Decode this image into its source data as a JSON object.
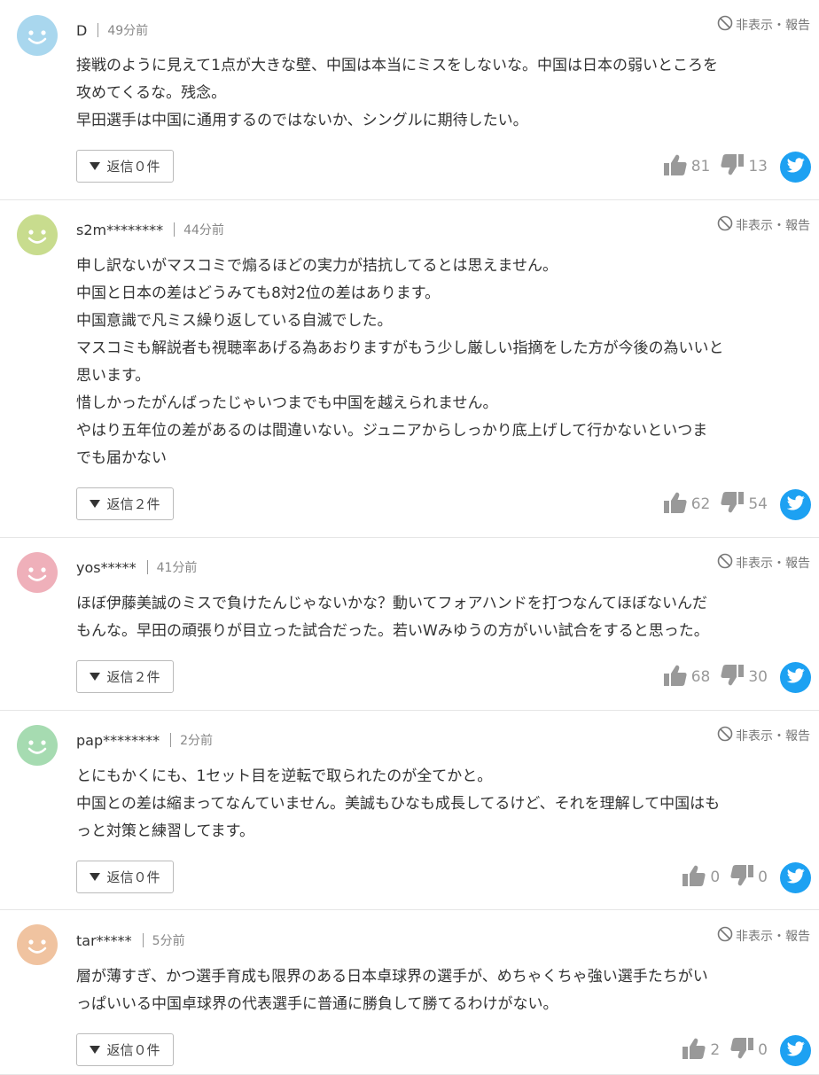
{
  "report_label": "非表示・報告",
  "comments": [
    {
      "user": "D",
      "time": "49分前",
      "avatar_color": "#a9d7ee",
      "lines": [
        "接戦のように見えて1点が大きな壁、中国は本当にミスをしないな。中国は日本の弱いところを",
        "攻めてくるな。残念。",
        "早田選手は中国に通用するのではないか、シングルに期待したい。"
      ],
      "reply_label": "返信０件",
      "likes": "81",
      "dislikes": "13"
    },
    {
      "user": "s2m********",
      "time": "44分前",
      "avatar_color": "#c8dc8e",
      "lines": [
        "申し訳ないがマスコミで煽るほどの実力が拮抗してるとは思えません。",
        "中国と日本の差はどうみても8対2位の差はあります。",
        "中国意識で凡ミス繰り返している自滅でした。",
        "マスコミも解説者も視聴率あげる為あおりますがもう少し厳しい指摘をした方が今後の為いいと",
        "思います。",
        "惜しかったがんばったじゃいつまでも中国を越えられません。",
        "やはり五年位の差があるのは間違いない。ジュニアからしっかり底上げして行かないといつま",
        "でも届かない"
      ],
      "reply_label": "返信２件",
      "likes": "62",
      "dislikes": "54"
    },
    {
      "user": "yos*****",
      "time": "41分前",
      "avatar_color": "#efb0ba",
      "lines": [
        "ほぼ伊藤美誠のミスで負けたんじゃないかな？動いてフォアハンドを打つなんてほぼないんだ",
        "もんな。早田の頑張りが目立った試合だった。若いWみゆうの方がいい試合をすると思った。"
      ],
      "reply_label": "返信２件",
      "likes": "68",
      "dislikes": "30"
    },
    {
      "user": "pap********",
      "time": "2分前",
      "avatar_color": "#a6dbb1",
      "lines": [
        "とにもかくにも、1セット目を逆転で取られたのが全てかと。",
        "中国との差は縮まってなんていません。美誠もひなも成長してるけど、それを理解して中国はも",
        "っと対策と練習してます。"
      ],
      "reply_label": "返信０件",
      "likes": "0",
      "dislikes": "0"
    },
    {
      "user": "tar*****",
      "time": "5分前",
      "avatar_color": "#f0c3a0",
      "lines": [
        "層が薄すぎ、かつ選手育成も限界のある日本卓球界の選手が、めちゃくちゃ強い選手たちがい",
        "っぱいいる中国卓球界の代表選手に普通に勝負して勝てるわけがない。"
      ],
      "reply_label": "返信０件",
      "likes": "2",
      "dislikes": "0"
    }
  ]
}
